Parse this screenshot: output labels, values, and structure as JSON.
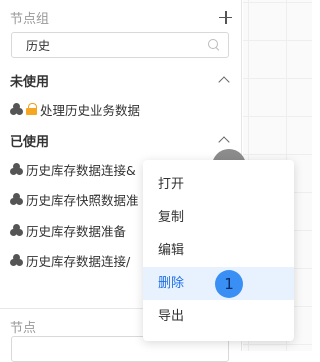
{
  "panel": {
    "title": "节点组",
    "search_value": "历史",
    "groups": [
      {
        "label": "未使用",
        "items": [
          {
            "label": "处理历史业务数据",
            "locked": true
          }
        ]
      },
      {
        "label": "已使用",
        "items": [
          {
            "label": "历史库存数据连接&"
          },
          {
            "label": "历史库存快照数据准"
          },
          {
            "label": "历史库存数据准备"
          },
          {
            "label": "历史库存数据连接/"
          }
        ]
      }
    ],
    "bottom_title": "节点"
  },
  "context_menu": {
    "items": [
      "打开",
      "复制",
      "编辑",
      "删除",
      "导出"
    ],
    "active_index": 3,
    "badge": "1"
  },
  "colors": {
    "accent": "#1e6fe8",
    "badge": "#3a8ff5",
    "lock": "#f5a623"
  }
}
